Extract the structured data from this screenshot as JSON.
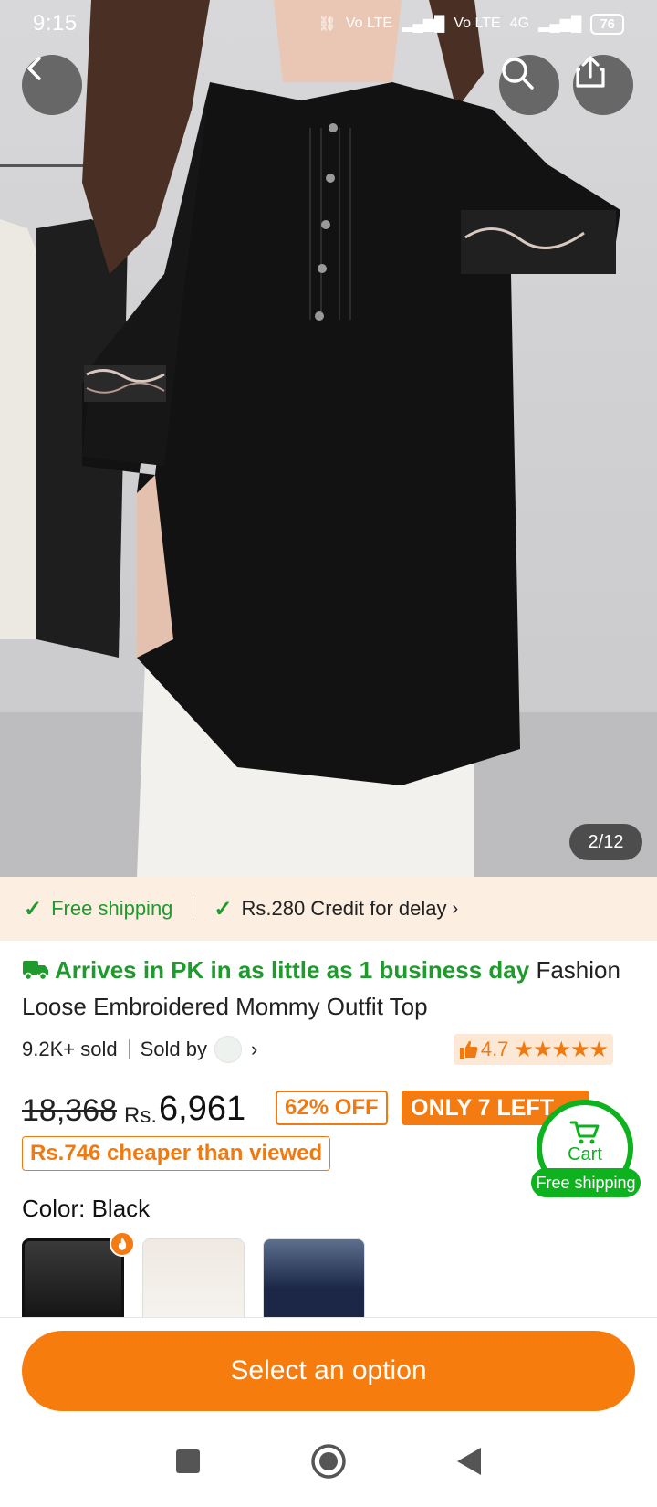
{
  "status_bar": {
    "time": "9:15",
    "network_1": "Vo LTE",
    "network_2": "Vo LTE",
    "network_type": "4G",
    "battery": "76"
  },
  "gallery": {
    "counter": "2/12"
  },
  "shipping_strip": {
    "free_shipping": "Free shipping",
    "credit": "Rs.280 Credit for delay"
  },
  "product": {
    "arrival": "Arrives in PK in as little as 1 business day",
    "title": "Fashion Loose Embroidered Mommy Outfit Top",
    "sold": "9.2K+ sold",
    "sold_by": "Sold by",
    "rating": "4.7",
    "stars": "★★★★★",
    "original_price": "18,368",
    "currency": "Rs.",
    "price": "6,961",
    "discount": "62% OFF",
    "stock": "ONLY 7 LEFT",
    "cheaper": "Rs.746 cheaper than viewed"
  },
  "cart_fab": {
    "label": "Cart",
    "shipping": "Free shipping"
  },
  "color": {
    "label": "Color: Black",
    "options": [
      "Black",
      "White",
      "Navy"
    ]
  },
  "cta": {
    "label": "Select an option"
  },
  "colors": {
    "accent_orange": "#f77c0e",
    "green": "#1f9a2d",
    "strip_bg": "#fdeee2"
  }
}
